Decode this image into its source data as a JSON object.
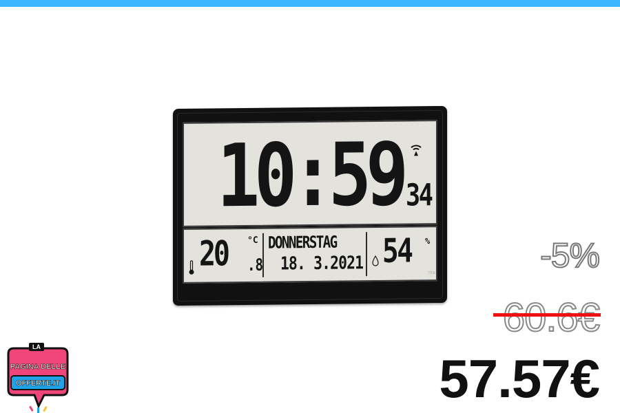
{
  "clock": {
    "time_hm": "10:59",
    "time_sec": "34",
    "temperature": "20",
    "temperature_decimal": ".8",
    "temperature_unit": "°C",
    "day": "DONNERSTAG",
    "date": "18. 3.2021",
    "humidity": "54",
    "humidity_unit": "%",
    "brand": "TFA"
  },
  "price": {
    "discount": "-5%",
    "old_price": "60.6€",
    "new_price": "57.57€"
  },
  "logo": {
    "line1": "LA",
    "line2": "PAGINA DELLE",
    "line3": "OFFERTE.IT"
  },
  "colors": {
    "top_bar": "#3cb4ff",
    "strike": "#ee1111",
    "logo_pink": "#f0457a",
    "logo_blue": "#1fa3e8"
  }
}
